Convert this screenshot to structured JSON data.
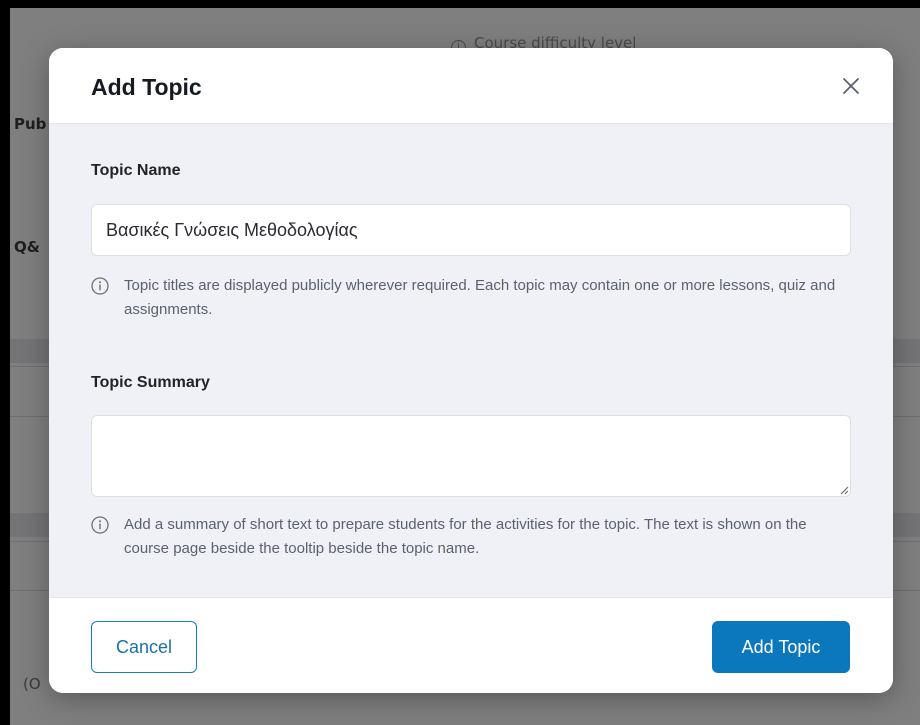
{
  "background": {
    "hint_text": "Course difficulty level",
    "label_pub": "Pub",
    "label_qa": "Q&",
    "label_opt": "(O"
  },
  "modal": {
    "title": "Add Topic",
    "topic_name": {
      "label": "Topic Name",
      "value": "Βασικές Γνώσεις Μεθοδολογίας",
      "help": "Topic titles are displayed publicly wherever required. Each topic may contain one or more lessons, quiz and assignments."
    },
    "topic_summary": {
      "label": "Topic Summary",
      "value": "",
      "help": "Add a summary of short text to prepare students for the activities for the topic. The text is shown on the course page beside the tooltip beside the topic name."
    },
    "buttons": {
      "cancel": "Cancel",
      "add": "Add Topic"
    }
  },
  "colors": {
    "primary": "#0b78be",
    "body_bg": "#eff1f6",
    "overlay": "#7f7f80"
  }
}
